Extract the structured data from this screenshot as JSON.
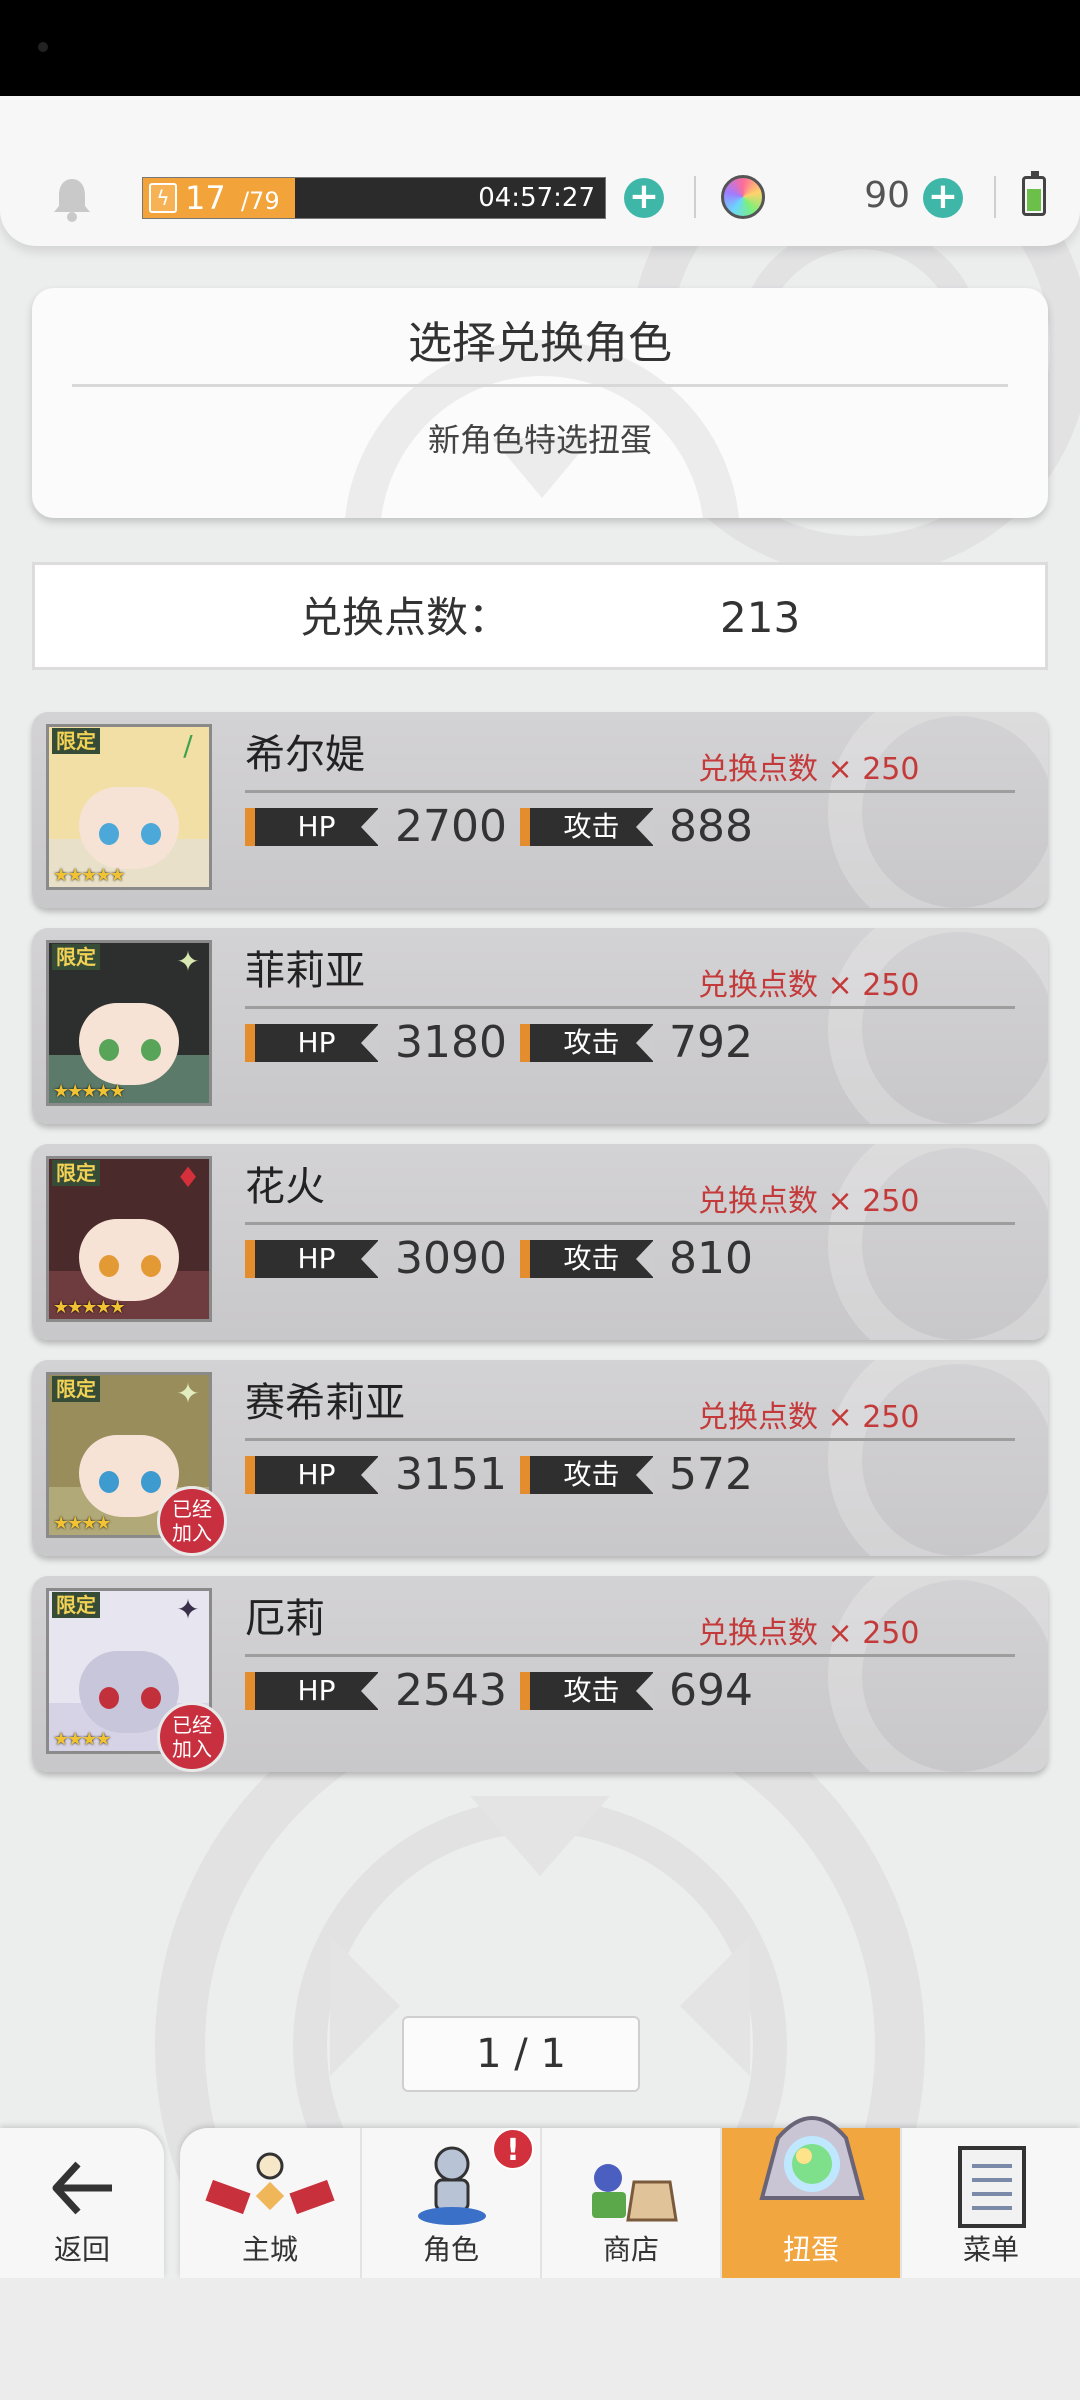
{
  "header": {
    "stamina_current": "17",
    "stamina_max": "/79",
    "stamina_fraction": 0.33,
    "stamina_timer": "04:57:27",
    "gem_count": "90"
  },
  "select_panel": {
    "title": "选择兑换角色",
    "subtitle": "新角色特选扭蛋"
  },
  "points": {
    "label": "兑换点数：",
    "value": "213"
  },
  "characters": [
    {
      "name": "希尔媞",
      "cost": "兑换点数 × 250",
      "hp_label": "HP",
      "hp": "2700",
      "atk_label": "攻击",
      "atk": "888",
      "limited": "限定",
      "stars": "★★★★★",
      "joined": ""
    },
    {
      "name": "菲莉亚",
      "cost": "兑换点数 × 250",
      "hp_label": "HP",
      "hp": "3180",
      "atk_label": "攻击",
      "atk": "792",
      "limited": "限定",
      "stars": "★★★★★",
      "joined": ""
    },
    {
      "name": "花火",
      "cost": "兑换点数 × 250",
      "hp_label": "HP",
      "hp": "3090",
      "atk_label": "攻击",
      "atk": "810",
      "limited": "限定",
      "stars": "★★★★★",
      "joined": ""
    },
    {
      "name": "赛希莉亚",
      "cost": "兑换点数 × 250",
      "hp_label": "HP",
      "hp": "3151",
      "atk_label": "攻击",
      "atk": "572",
      "limited": "限定",
      "stars": "★★★★",
      "joined": "已经加入"
    },
    {
      "name": "厄莉",
      "cost": "兑换点数 × 250",
      "hp_label": "HP",
      "hp": "2543",
      "atk_label": "攻击",
      "atk": "694",
      "limited": "限定",
      "stars": "★★★★",
      "joined": "已经加入"
    }
  ],
  "pager": {
    "text": "1 / 1"
  },
  "nav": {
    "back": "返回",
    "tabs": [
      {
        "label": "主城",
        "icon": "castle-icon"
      },
      {
        "label": "角色",
        "icon": "character-icon",
        "badge": "!"
      },
      {
        "label": "商店",
        "icon": "shop-icon"
      },
      {
        "label": "扭蛋",
        "icon": "gacha-icon",
        "active": true
      },
      {
        "label": "菜单",
        "icon": "menu-list-icon"
      }
    ]
  },
  "colors": {
    "accent_orange": "#f2a640",
    "cost_red": "#c43a3a",
    "plus_teal": "#3fb7a8",
    "badge_red": "#d1303c"
  }
}
